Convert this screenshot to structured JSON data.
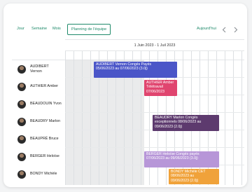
{
  "toolbar": {
    "views": [
      "Jour",
      "Semaine",
      "Mois"
    ],
    "active_view": "Planning de l'équipe",
    "today": "Aujourd'hui"
  },
  "period_label": "1 Juin 2023 - 1 Juil 2023",
  "employees": [
    {
      "name_line1": "AUDIBERT",
      "name_line2": "Vernon"
    },
    {
      "name_line1": "AUTHIER Amber",
      "name_line2": ""
    },
    {
      "name_line1": "BEAUDOUIN Yvon",
      "name_line2": ""
    },
    {
      "name_line1": "BEAUDRY Marlon",
      "name_line2": ""
    },
    {
      "name_line1": "BEAUPRÉ Bruce",
      "name_line2": ""
    },
    {
      "name_line1": "BERGER Heloïse",
      "name_line2": ""
    },
    {
      "name_line1": "BONDY Michèle",
      "name_line2": ""
    }
  ],
  "events": [
    {
      "line1": "AUDIBERT Vernon Congés Payés",
      "line2": "05/06/2023 au 07/06/2023 (3.0j)",
      "line3": "",
      "color": "#4b56c8"
    },
    {
      "line1": "AUTHIER Amber",
      "line2": "Télétravail",
      "line3": "07/06/2023",
      "color": "#e0456f"
    },
    {
      "line1": "BEAUDRY Marlon Congés",
      "line2": "exceptionnels  08/06/2023 au",
      "line3": "09/06/2023 (2.0j)",
      "color": "#5d3a6e"
    },
    {
      "line1": "BERGER Heloïse Congés payés",
      "line2": "07/06/2023 au 09/06/2023 (3.0j)",
      "line3": "",
      "color": "#b796d8"
    },
    {
      "line1": "BONDY Michèle CET",
      "line2": "08/06/2023 au",
      "line3": "09/06/2023 (2.0j)",
      "color": "#f0a23a"
    }
  ],
  "colors": {
    "accent": "#1f8a6a"
  }
}
